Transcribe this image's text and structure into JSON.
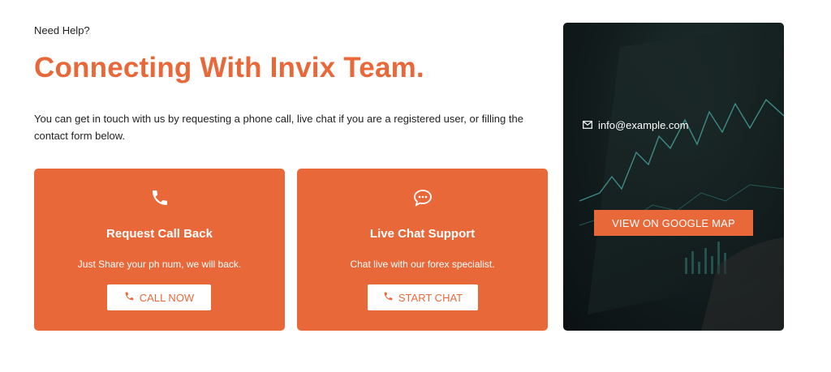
{
  "header": {
    "eyebrow": "Need Help?",
    "headline": "Connecting With Invix Team.",
    "intro": "You can get in touch with us by requesting a phone call, live chat if you are a registered user, or filling the contact form below."
  },
  "cards": [
    {
      "icon": "phone-icon",
      "title": "Request Call Back",
      "description": "Just Share your ph num, we will back.",
      "button_label": "CALL NOW",
      "button_icon": "phone-icon"
    },
    {
      "icon": "chat-bubble-icon",
      "title": "Live Chat Support",
      "description": "Chat live with our forex specialist.",
      "button_label": "START CHAT",
      "button_icon": "phone-icon"
    }
  ],
  "contact": {
    "email_icon": "envelope-icon",
    "email": "info@example.com",
    "map_button": "VIEW ON GOOGLE MAP"
  },
  "colors": {
    "accent": "#e8683a",
    "text": "#1f1f1f",
    "panel_dark": "#121c1d"
  }
}
